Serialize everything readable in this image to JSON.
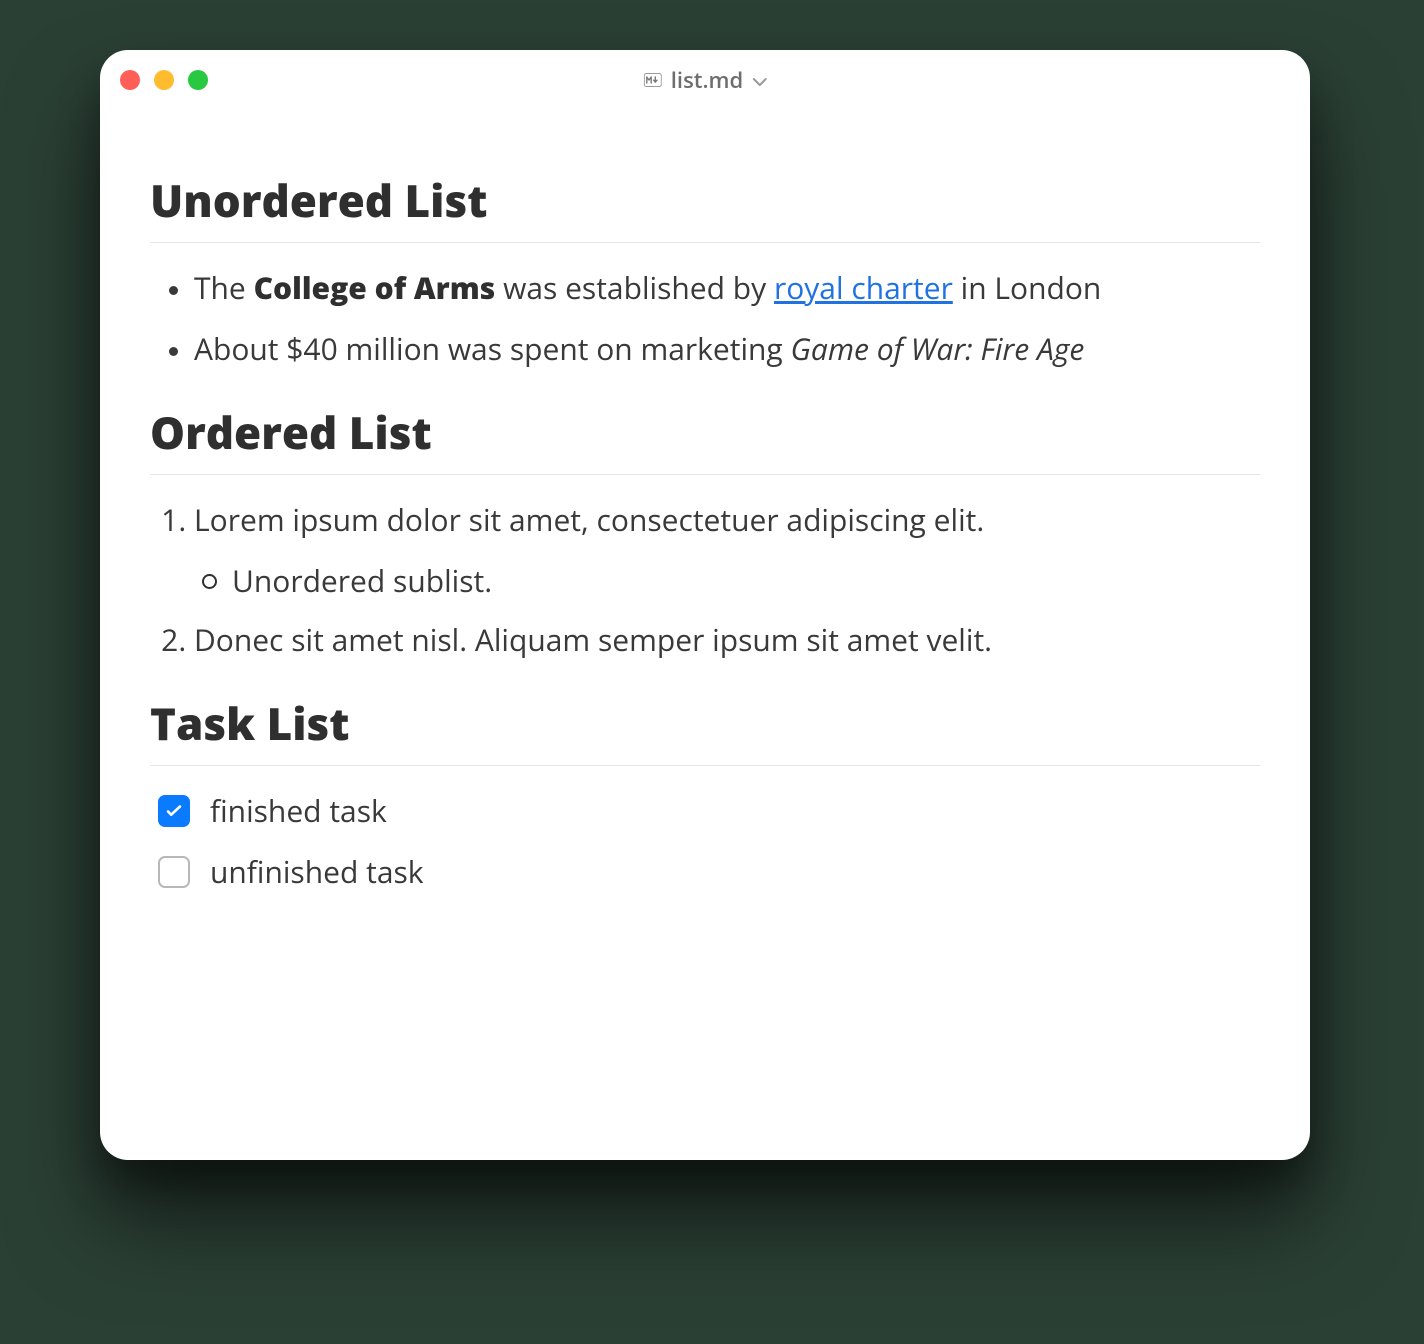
{
  "window": {
    "filename": "list.md"
  },
  "headings": {
    "unordered": "Unordered List",
    "ordered": "Ordered List",
    "task": "Task List"
  },
  "unordered": {
    "item1": {
      "pre": "The ",
      "bold": "College of Arms",
      "mid": " was established by ",
      "link": "royal charter",
      "post": " in London"
    },
    "item2": {
      "pre": "About $40 million was spent on marketing ",
      "italic": "Game of War: Fire Age"
    }
  },
  "ordered": {
    "item1": "Lorem ipsum dolor sit amet, consectetuer adipiscing elit.",
    "item1_sub1": "Unordered sublist.",
    "item2": "Donec sit amet nisl. Aliquam semper ipsum sit amet velit."
  },
  "tasks": {
    "item1": {
      "label": "finished task",
      "checked": true
    },
    "item2": {
      "label": "unfinished task",
      "checked": false
    }
  }
}
